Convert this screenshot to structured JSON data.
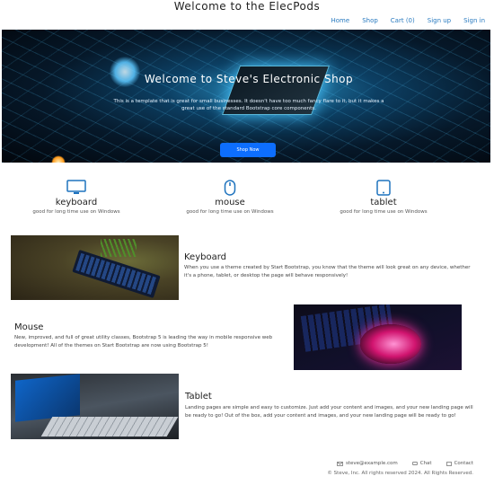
{
  "header": {
    "title": "Welcome to the ElecPods",
    "nav": [
      "Home",
      "Shop",
      "Cart (0)",
      "Sign up",
      "Sign in"
    ]
  },
  "hero": {
    "title": "Welcome to Steve's Electronic Shop",
    "subtitle": "This is a template that is great for small businesses. It doesn't have too much fancy flare to it, but it makes a great use of the standard Bootstrap core components.",
    "button": "Shop Now"
  },
  "features": [
    {
      "title": "keyboard",
      "desc": "good for long time use on Windows",
      "icon": "monitor-icon"
    },
    {
      "title": "mouse",
      "desc": "good for long time use on Windows",
      "icon": "mouse-icon"
    },
    {
      "title": "tablet",
      "desc": "good for long time use on Windows",
      "icon": "tablet-icon"
    }
  ],
  "sections": [
    {
      "title": "Keyboard",
      "text": "When you use a theme created by Start Bootstrap, you know that the theme will look great on any device, whether it's a phone, tablet, or desktop the page will behave responsively!"
    },
    {
      "title": "Mouse",
      "text": "New, improved, and full of great utility classes, Bootstrap 5 is leading the way in mobile responsive web development! All of the themes on Start Bootstrap are now using Bootstrap 5!"
    },
    {
      "title": "Tablet",
      "text": "Landing pages are simple and easy to customize. Just add your content and images, and your new landing page will be ready to go! Out of the box, add your content and images, and your new landing page will be ready to go!"
    }
  ],
  "footer": {
    "email": "steve@example.com",
    "links": [
      "Chat",
      "Contact"
    ],
    "copyright": "© Steve, Inc. All rights reserved 2024. All Rights Reserved."
  },
  "colors": {
    "accent": "#0d6efd",
    "nav_link": "#2a7bc0"
  }
}
